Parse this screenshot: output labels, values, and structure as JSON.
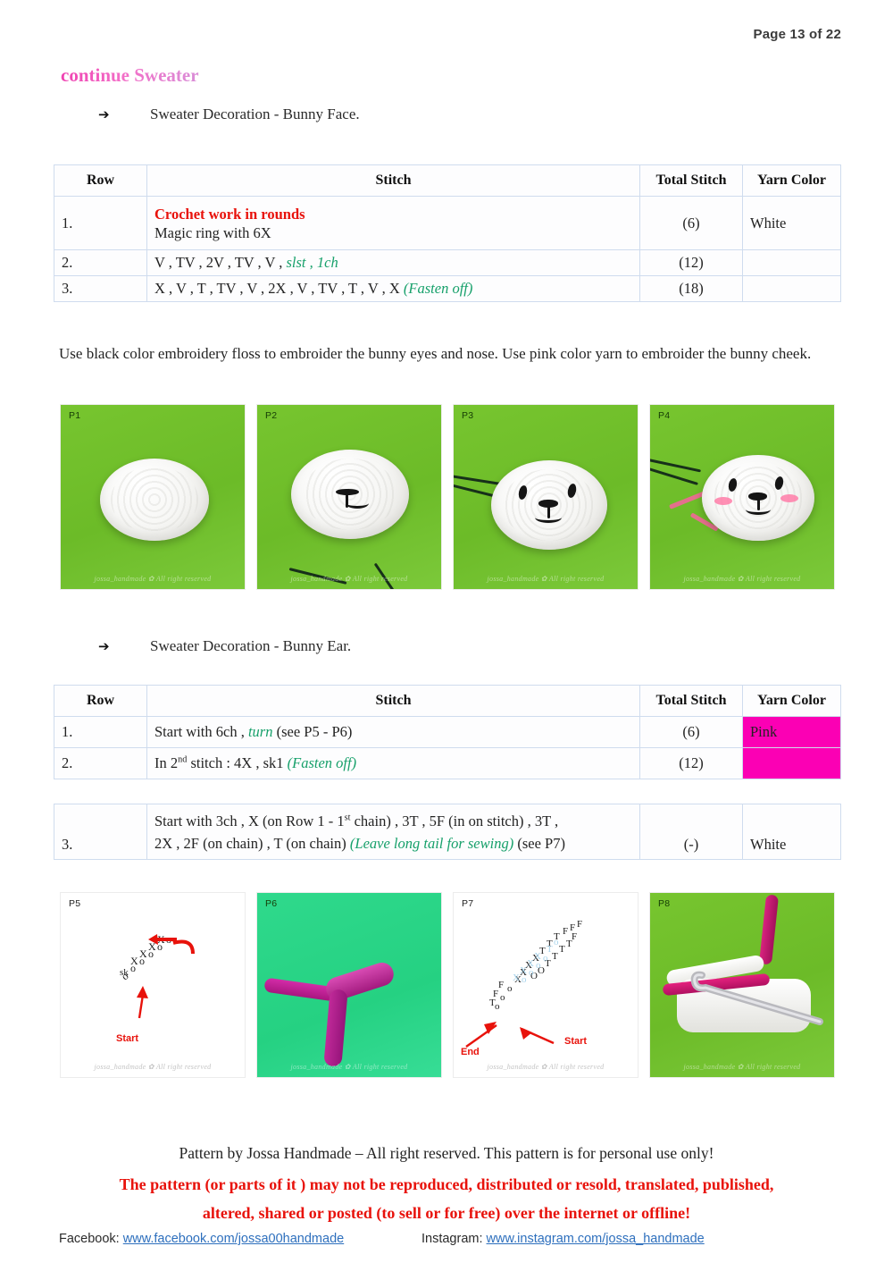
{
  "header": {
    "page_label": "Page 13 of 22",
    "section_title": "continue Sweater"
  },
  "bullets": {
    "face": "Sweater Decoration - Bunny Face.",
    "ear": "Sweater Decoration - Bunny Ear.",
    "arrow_glyph": "➔"
  },
  "table_face": {
    "headers": [
      "Row",
      "Stitch",
      "Total Stitch",
      "Yarn Color"
    ],
    "rows": [
      {
        "row": "1.",
        "stitch_heading": "Crochet work in rounds",
        "stitch": "Magic ring with 6X",
        "total": "(6)",
        "yarn": "White"
      },
      {
        "row": "2.",
        "stitch": "V , TV , 2V , TV , V , ",
        "stitch_italic": "slst , 1ch",
        "total": "(12)",
        "yarn": ""
      },
      {
        "row": "3.",
        "stitch": "X , V , T , TV , V , 2X , V , TV , T , V , X ",
        "stitch_italic": "(Fasten off)",
        "total": "(18)",
        "yarn": ""
      }
    ]
  },
  "paragraph": "Use black color embroidery floss to embroider the bunny eyes and nose. Use pink color yarn to embroider the bunny cheek.",
  "photos_row1": [
    {
      "tag": "P1",
      "watermark": "jossa_handmade ✿ All right reserved",
      "caption": "white crochet oval on green background"
    },
    {
      "tag": "P2",
      "watermark": "jossa_handmade ✿ All right reserved",
      "caption": "white crochet oval with black nose and mouth, floss tails"
    },
    {
      "tag": "P3",
      "watermark": "jossa_handmade ✿ All right reserved",
      "caption": "bunny face with eyes, nose and smile"
    },
    {
      "tag": "P4",
      "watermark": "jossa_handmade ✿ All right reserved",
      "caption": "bunny face with pink cheeks and pink yarn"
    }
  ],
  "table_ear": {
    "headers": [
      "Row",
      "Stitch",
      "Total Stitch",
      "Yarn Color"
    ],
    "rows": [
      {
        "row": "1.",
        "stitch_pre": "Start with 6ch , ",
        "stitch_italic": "turn",
        "stitch_post": " (see P5 - P6)",
        "total": "(6)",
        "yarn": "Pink"
      },
      {
        "row": "2.",
        "stitch_pre": "In 2nd stitch : 4X , sk1 ",
        "stitch_italic": "(Fasten off)",
        "stitch_post": "",
        "total": "(12)",
        "yarn": ""
      }
    ]
  },
  "table_ear2": {
    "row": "3.",
    "stitch_line1_pre": "Start with 3ch , X (on Row 1 - 1",
    "stitch_line1_sup": "st",
    "stitch_line1_post": " chain) , 3T , 5F (in on stitch) , 3T ,",
    "stitch_line2_pre": "2X , 2F (on chain) , T (on chain) ",
    "stitch_line2_italic": "(Leave long tail for sewing)",
    "stitch_line2_post": " (see P7)",
    "total": "(-)",
    "yarn": "White"
  },
  "photos_row2": [
    {
      "tag": "P5",
      "watermark": "jossa_handmade ✿ All right reserved",
      "start_label": "Start",
      "caption": "chain diagram with turn arrow"
    },
    {
      "tag": "P6",
      "watermark": "jossa_handmade ✿ All right reserved",
      "caption": "pink crochet ear piece on teal background"
    },
    {
      "tag": "P7",
      "watermark": "jossa_handmade ✿ All right reserved",
      "start_label": "Start",
      "end_label": "End",
      "caption": "stitch chart diagram for ear"
    },
    {
      "tag": "P8",
      "watermark": "jossa_handmade ✿ All right reserved",
      "caption": "white crochet with pink yarn and metal hook"
    }
  ],
  "footer": {
    "line1": "Pattern by Jossa Handmade – All right reserved. This pattern is for personal use only!",
    "line2": "The pattern (or parts of it ) may not be reproduced, distributed or resold, translated, published,",
    "line3": "altered, shared or posted (to sell or for free) over the internet or offline!",
    "facebook_label": "Facebook:",
    "facebook_url": "www.facebook.com/jossa00handmade",
    "instagram_label": "Instagram:",
    "instagram_url": "www.instagram.com/jossa_handmade"
  },
  "colors": {
    "title_pink": "#f05ac0",
    "red": "#e8120b",
    "green_italic": "#16a06a",
    "pink_cell": "#fb00b4",
    "link_blue": "#2d6fbd",
    "table_border": "#cfdcee",
    "photo_green": "#6cbb28",
    "photo_teal": "#25d182"
  }
}
